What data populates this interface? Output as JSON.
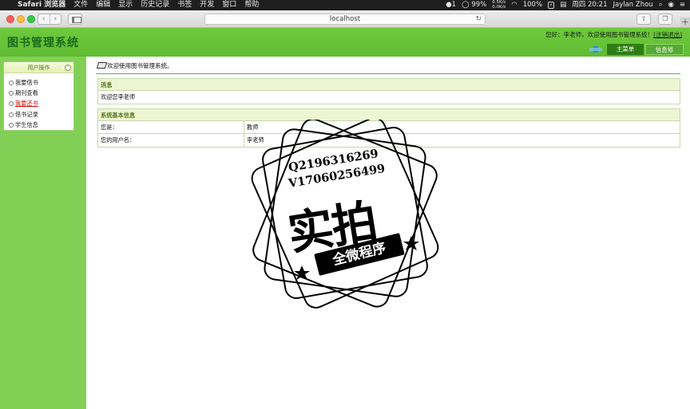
{
  "menubar": {
    "apple_glyph": "",
    "app_name": "Safari 浏览器",
    "items": [
      "文件",
      "编辑",
      "显示",
      "历史记录",
      "书签",
      "开发",
      "窗口",
      "帮助"
    ],
    "status": {
      "notifications": "1",
      "battery_percent": "99%",
      "net_up": "0.5K/s",
      "net_down": "0.0K/s",
      "wifi_percent": "100%",
      "date_time": "周四 20:21",
      "user": "Jaylan Zhou"
    }
  },
  "browser": {
    "back": "‹",
    "forward": "›",
    "address": "localhost",
    "reload": "↻"
  },
  "app": {
    "logo": "图书管理系统",
    "welcome_prefix": "您好：",
    "user_name": "李老师",
    "welcome_suffix": "，欢迎使用图书管理系统！",
    "logout": "[注销退出]",
    "tabs": [
      "主菜单",
      "信息修改"
    ]
  },
  "sidebar": {
    "title": "用户操作",
    "collapse_glyph": "⌃",
    "items": [
      "我要借书",
      "期刊查看",
      "我要还书",
      "借书记录",
      "学生信息"
    ],
    "active_index": 2
  },
  "content": {
    "breadcrumb": "欢迎使用图书管理系统。",
    "message_box": {
      "title": "消息",
      "text": "欢迎您李老师"
    },
    "info_box": {
      "title": "系统基本信息",
      "rows": [
        {
          "label": "您是：",
          "value": "教师"
        },
        {
          "label": "您的用户名：",
          "value": "李老师"
        }
      ]
    }
  },
  "watermark": {
    "line1": "Q2196316269",
    "line2": "V17060256499",
    "big": "实拍",
    "ribbon": "全微程序"
  }
}
